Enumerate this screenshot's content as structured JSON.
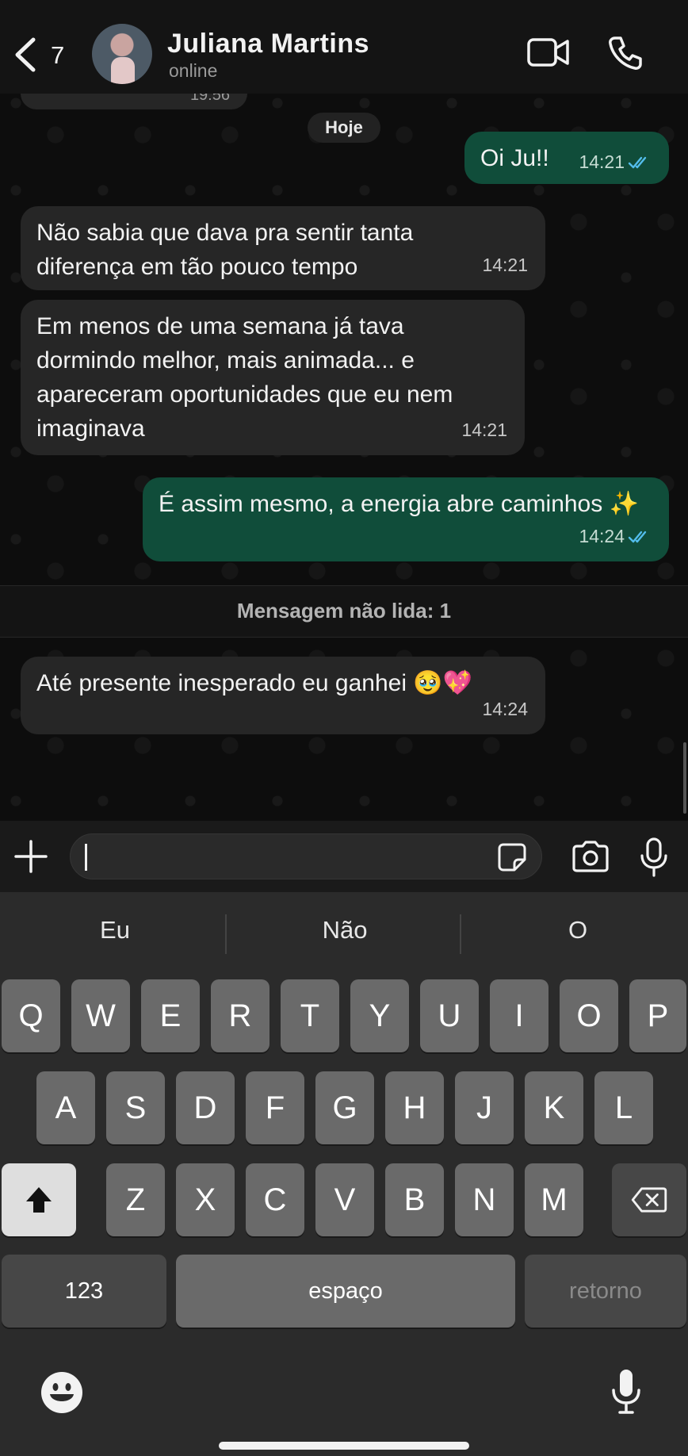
{
  "header": {
    "back_count": "7",
    "contact_name": "Juliana Martins",
    "contact_status": "online"
  },
  "chat": {
    "previous_message_time": "19:56",
    "date_separator": "Hoje",
    "messages": [
      {
        "direction": "out",
        "text": "Oi Ju!!",
        "time": "14:21",
        "status": "read"
      },
      {
        "direction": "in",
        "text": "Não sabia que dava pra sentir tanta diferença em tão pouco tempo",
        "time": "14:21"
      },
      {
        "direction": "in",
        "text": "Em menos de uma semana já tava dormindo melhor, mais animada... e apareceram oportunidades que eu nem imaginava",
        "time": "14:21"
      },
      {
        "direction": "out",
        "text": "É assim mesmo, a energia abre caminhos ✨",
        "time": "14:24",
        "status": "read"
      },
      {
        "direction": "in",
        "text": "Até presente inesperado eu ganhei 🥹💖",
        "time": "14:24"
      }
    ],
    "unread_banner": "Mensagem não lida: 1"
  },
  "composer": {
    "input_value": "",
    "icons": [
      "plus-icon",
      "sticker-icon",
      "camera-icon",
      "microphone-icon"
    ]
  },
  "keyboard": {
    "suggestions": [
      "Eu",
      "Não",
      "O"
    ],
    "row1": [
      "Q",
      "W",
      "E",
      "R",
      "T",
      "Y",
      "U",
      "I",
      "O",
      "P"
    ],
    "row2": [
      "A",
      "S",
      "D",
      "F",
      "G",
      "H",
      "J",
      "K",
      "L"
    ],
    "row3": [
      "Z",
      "X",
      "C",
      "V",
      "B",
      "N",
      "M"
    ],
    "numbers_label": "123",
    "space_label": "espaço",
    "return_label": "retorno",
    "icons": [
      "shift-icon",
      "backspace-icon",
      "emoji-icon",
      "dictation-icon"
    ]
  },
  "colors": {
    "outgoing_bubble": "#104d3a",
    "incoming_bubble": "#262626",
    "read_ticks": "#53bdeb",
    "key": "#6a6a6a",
    "key_dark": "#474747"
  }
}
